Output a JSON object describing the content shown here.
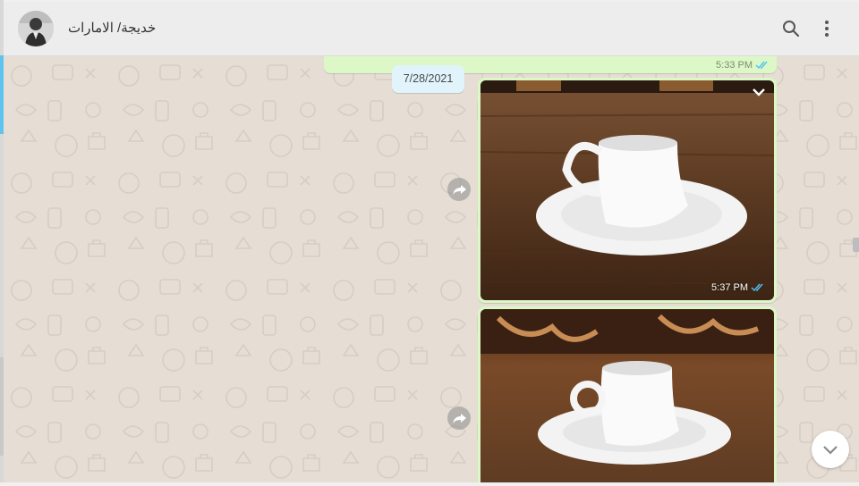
{
  "header": {
    "contact_name": "خديجة/ الامارات",
    "icons": [
      "avatar",
      "search-icon",
      "menu-icon"
    ]
  },
  "messages": {
    "previous_time": "5:33 PM",
    "date_chip": "7/28/2021",
    "image1_time": "5:37 PM",
    "read_status": "double-check-icon"
  },
  "colors": {
    "header_bg": "#ededed",
    "chat_bg": "#e6ddd4",
    "outgoing_bubble": "#dcf8c6",
    "date_chip_bg": "#e1f3fb",
    "tick_blue": "#4fc3f7"
  }
}
